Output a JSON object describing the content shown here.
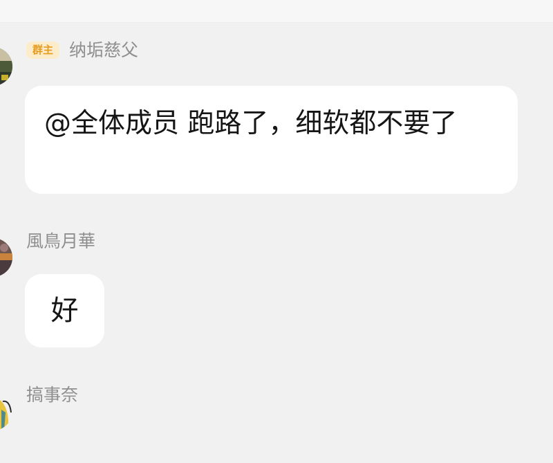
{
  "messages": [
    {
      "badge": "群主",
      "sender": "纳垢慈父",
      "text": "@全体成员 跑路了，细软都不要了"
    },
    {
      "sender": "風鳥月華",
      "text": "好"
    },
    {
      "sender": "搞事奈"
    }
  ]
}
